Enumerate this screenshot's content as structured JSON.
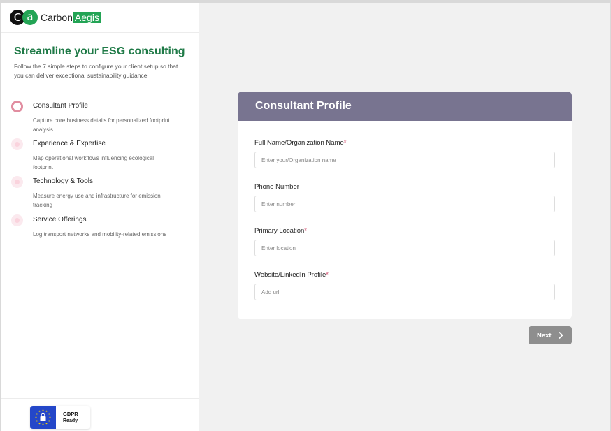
{
  "brand": {
    "mark_c": "C",
    "mark_a": "a",
    "word1": "Carbon",
    "word2": "Aegis",
    "accent": "#23a455"
  },
  "sidebar": {
    "headline": "Streamline your ESG consulting",
    "subline": "Follow the 7 simple steps to configure your client setup so that you can deliver exceptional sustainability guidance",
    "steps": [
      {
        "title": "Consultant Profile",
        "desc": "Capture core business details for personalized footprint analysis",
        "state": "active"
      },
      {
        "title": "Experience & Expertise",
        "desc": "Map operational workflows influencing ecological footprint",
        "state": "inactive"
      },
      {
        "title": "Technology & Tools",
        "desc": "Measure energy use and infrastructure for emission tracking",
        "state": "inactive"
      },
      {
        "title": "Service Offerings",
        "desc": "Log transport networks and mobility-related emissions",
        "state": "inactive"
      }
    ],
    "gdpr": {
      "line1": "GDPR",
      "line2": "Ready"
    }
  },
  "form": {
    "title": "Consultant Profile",
    "header_color": "#787490",
    "fields": [
      {
        "label": "Full Name/Organization Name",
        "required": "*",
        "placeholder": "Enter your/Organization name",
        "value": ""
      },
      {
        "label": "Phone Number",
        "required": "",
        "placeholder": "Enter number",
        "value": ""
      },
      {
        "label": "Primary Location",
        "required": "*",
        "placeholder": "Enter location",
        "value": ""
      },
      {
        "label": "Website/LinkedIn Profile",
        "required": "*",
        "placeholder": "Add url",
        "value": ""
      }
    ],
    "next_label": "Next",
    "next_icon": "chevron-right-icon"
  }
}
